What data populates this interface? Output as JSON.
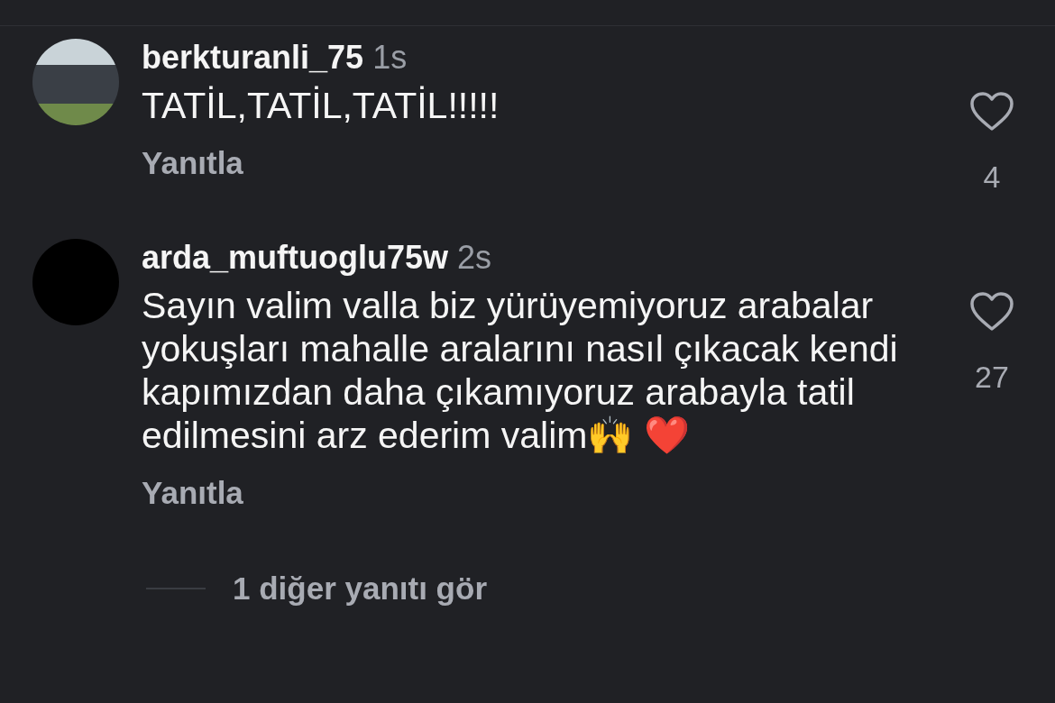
{
  "comments": [
    {
      "kind": "photo",
      "username": "berkturanli_75",
      "time": "1s",
      "text": "TATİL,TATİL,TATİL!!!!!",
      "reply": "Yanıtla",
      "likes": "4",
      "liked": false
    },
    {
      "kind": "plain",
      "username": "arda_muftuoglu75w",
      "time": "2s",
      "text": "Sayın valim valla biz yürüyemiyoruz arabalar yokuşları mahalle aralarını nasıl çıkacak kendi kapımızdan daha çıkamıyoruz arabayla tatil edilmesini arz ederim valim🙌 ❤️",
      "reply": "Yanıtla",
      "likes": "27",
      "liked": false
    }
  ],
  "more_replies": "1 diğer yanıtı gör"
}
